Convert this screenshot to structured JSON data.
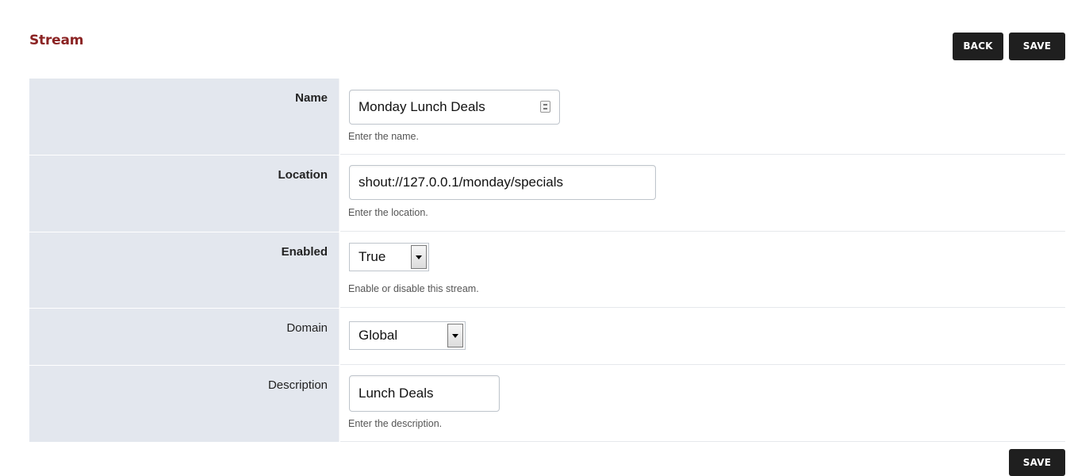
{
  "page": {
    "title": "Stream"
  },
  "toolbar": {
    "back_label": "BACK",
    "save_label": "SAVE"
  },
  "footer": {
    "save_label": "SAVE"
  },
  "form": {
    "name": {
      "label": "Name",
      "value": "Monday Lunch Deals",
      "hint": "Enter the name."
    },
    "location": {
      "label": "Location",
      "value": "shout://127.0.0.1/monday/specials",
      "hint": "Enter the location."
    },
    "enabled": {
      "label": "Enabled",
      "value": "True",
      "hint": "Enable or disable this stream."
    },
    "domain": {
      "label": "Domain",
      "value": "Global"
    },
    "description": {
      "label": "Description",
      "value": "Lunch Deals",
      "hint": "Enter the description."
    }
  },
  "colors": {
    "title": "#8b2323",
    "button_bg": "#1f1f1f",
    "label_cell_bg": "#e3e7ee"
  },
  "icons": {
    "name_field_icon": "password-manager-key-icon",
    "select_arrow": "chevron-down-icon"
  }
}
